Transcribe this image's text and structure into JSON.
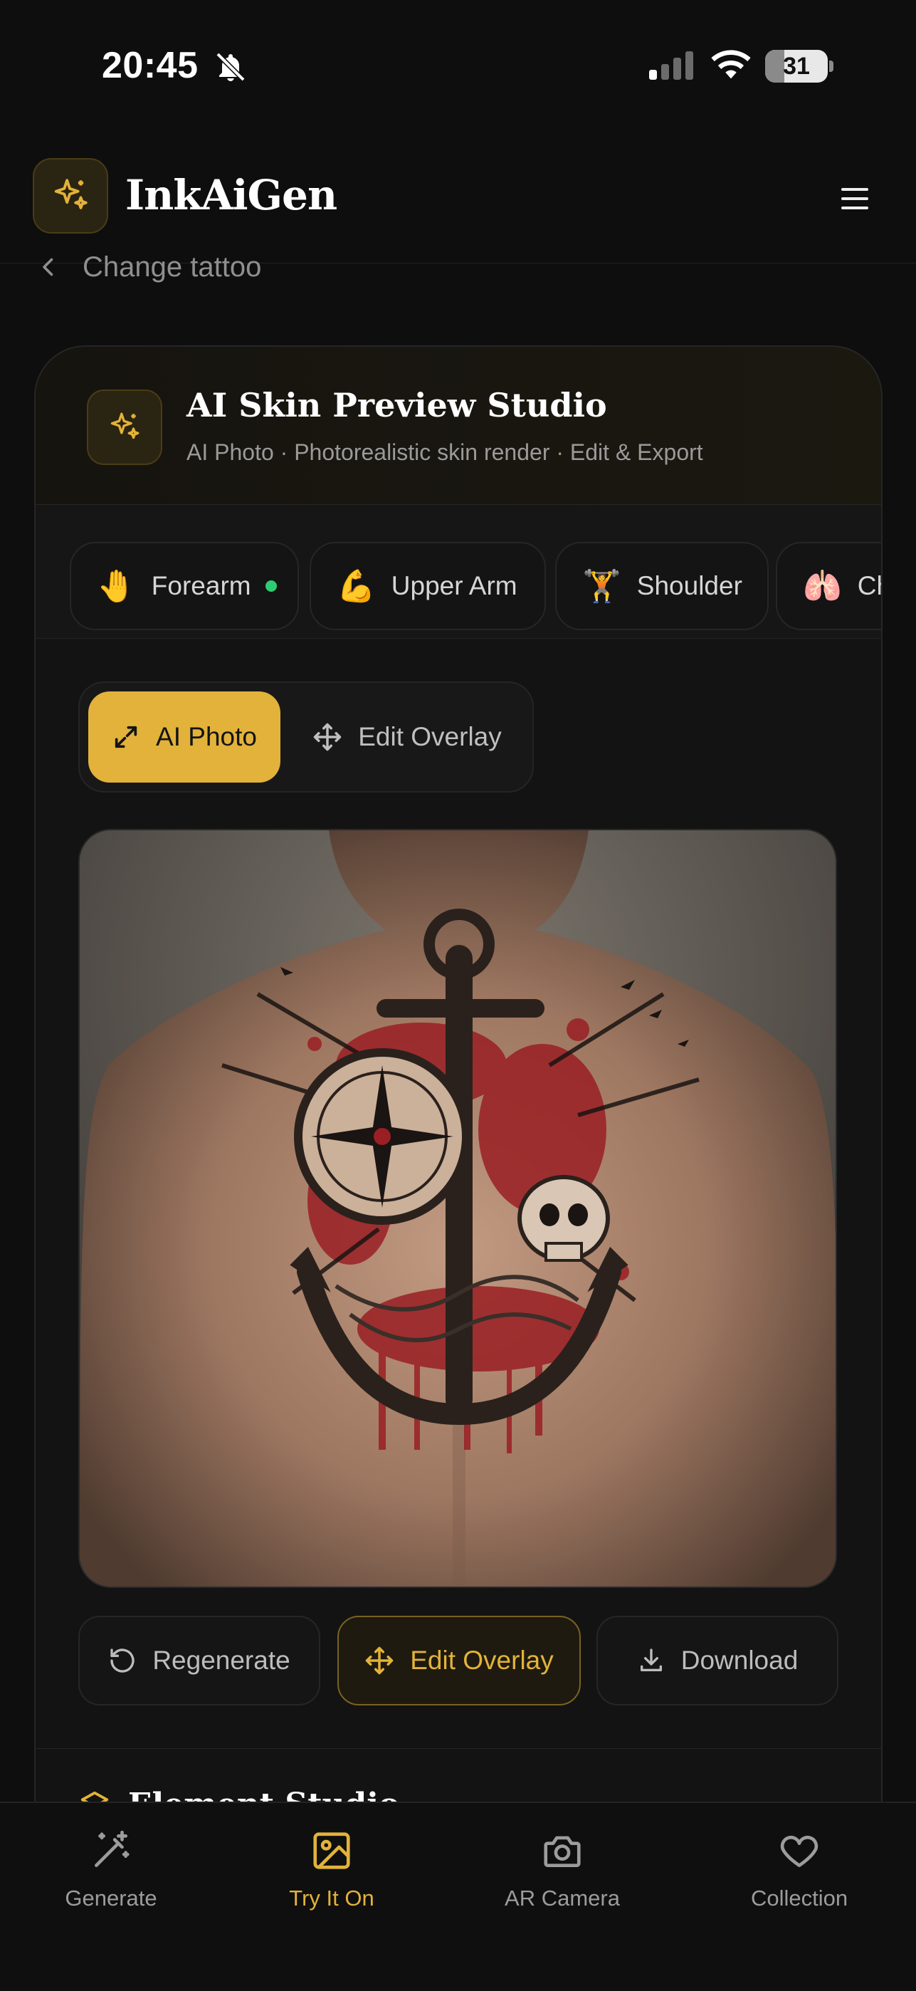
{
  "status_bar": {
    "time": "20:45",
    "battery": "31",
    "battery_level": 0.31
  },
  "header": {
    "app_name": "InkAiGen"
  },
  "back_link": {
    "label": "Change tattoo"
  },
  "studio": {
    "title": "AI Skin Preview Studio",
    "subtitle": "AI Photo · Photorealistic skin render · Edit & Export",
    "regions": [
      {
        "emoji": "🤚",
        "label": "Forearm",
        "active": true
      },
      {
        "emoji": "💪",
        "label": "Upper Arm",
        "active": false
      },
      {
        "emoji": "🏋",
        "label": "Shoulder",
        "active": false
      },
      {
        "emoji": "🫁",
        "label": "Chest",
        "active": false
      }
    ],
    "mode_toggle": {
      "ai_photo": "AI Photo",
      "edit_overlay": "Edit Overlay"
    },
    "actions": {
      "regenerate": "Regenerate",
      "edit_overlay": "Edit Overlay",
      "download": "Download"
    },
    "next_section": "Element Studio"
  },
  "bottom_nav": [
    {
      "label": "Generate",
      "icon": "magic-wand-icon",
      "active": false
    },
    {
      "label": "Try It On",
      "icon": "image-icon",
      "active": true
    },
    {
      "label": "AR Camera",
      "icon": "camera-icon",
      "active": false
    },
    {
      "label": "Collection",
      "icon": "heart-icon",
      "active": false
    }
  ],
  "colors": {
    "accent": "#e2b23a",
    "background": "#0e0e0e",
    "active_dot": "#2ecc71"
  }
}
